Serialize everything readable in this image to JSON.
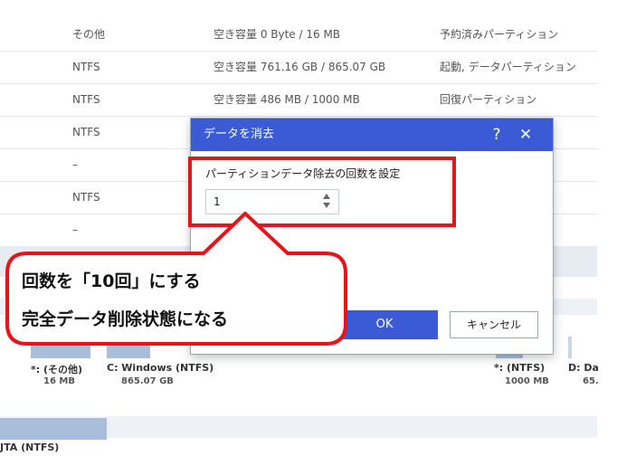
{
  "partition_rows": [
    {
      "fs": "その他",
      "capacity": "空き容量 0 Byte / 16 MB",
      "type": "予約済みパーティション"
    },
    {
      "fs": "NTFS",
      "capacity": "空き容量 761.16 GB / 865.07 GB",
      "type": "起動, データパーティション"
    },
    {
      "fs": "NTFS",
      "capacity": "空き容量 486 MB / 1000 MB",
      "type": "回復パーティション"
    },
    {
      "fs": "NTFS",
      "capacity": "",
      "type": ""
    },
    {
      "fs": "–",
      "capacity": "",
      "type": ""
    },
    {
      "fs": "NTFS",
      "capacity": "",
      "type": ""
    },
    {
      "fs": "–",
      "capacity": "",
      "type": ""
    }
  ],
  "disk_map": {
    "segments": [
      {
        "label": "*: (その他)",
        "size": "16 MB"
      },
      {
        "label": "C: Windows (NTFS)",
        "size": "865.07 GB"
      },
      {
        "label": "*: (NTFS)",
        "size": "1000 MB"
      },
      {
        "label": "D: Da",
        "size": "65."
      }
    ],
    "second_disk_label": "JTA (NTFS)"
  },
  "dialog": {
    "title": "データを消去",
    "help_icon": "?",
    "close_icon": "✕",
    "field_label": "パーティションデータ除去の回数を設定",
    "count_value": "1",
    "ok_label": "OK",
    "cancel_label": "キャンセル"
  },
  "annotation": {
    "line1": "回数を「10回」にする",
    "line2": "完全データ削除状態になる",
    "accent_color": "#e8131b"
  }
}
